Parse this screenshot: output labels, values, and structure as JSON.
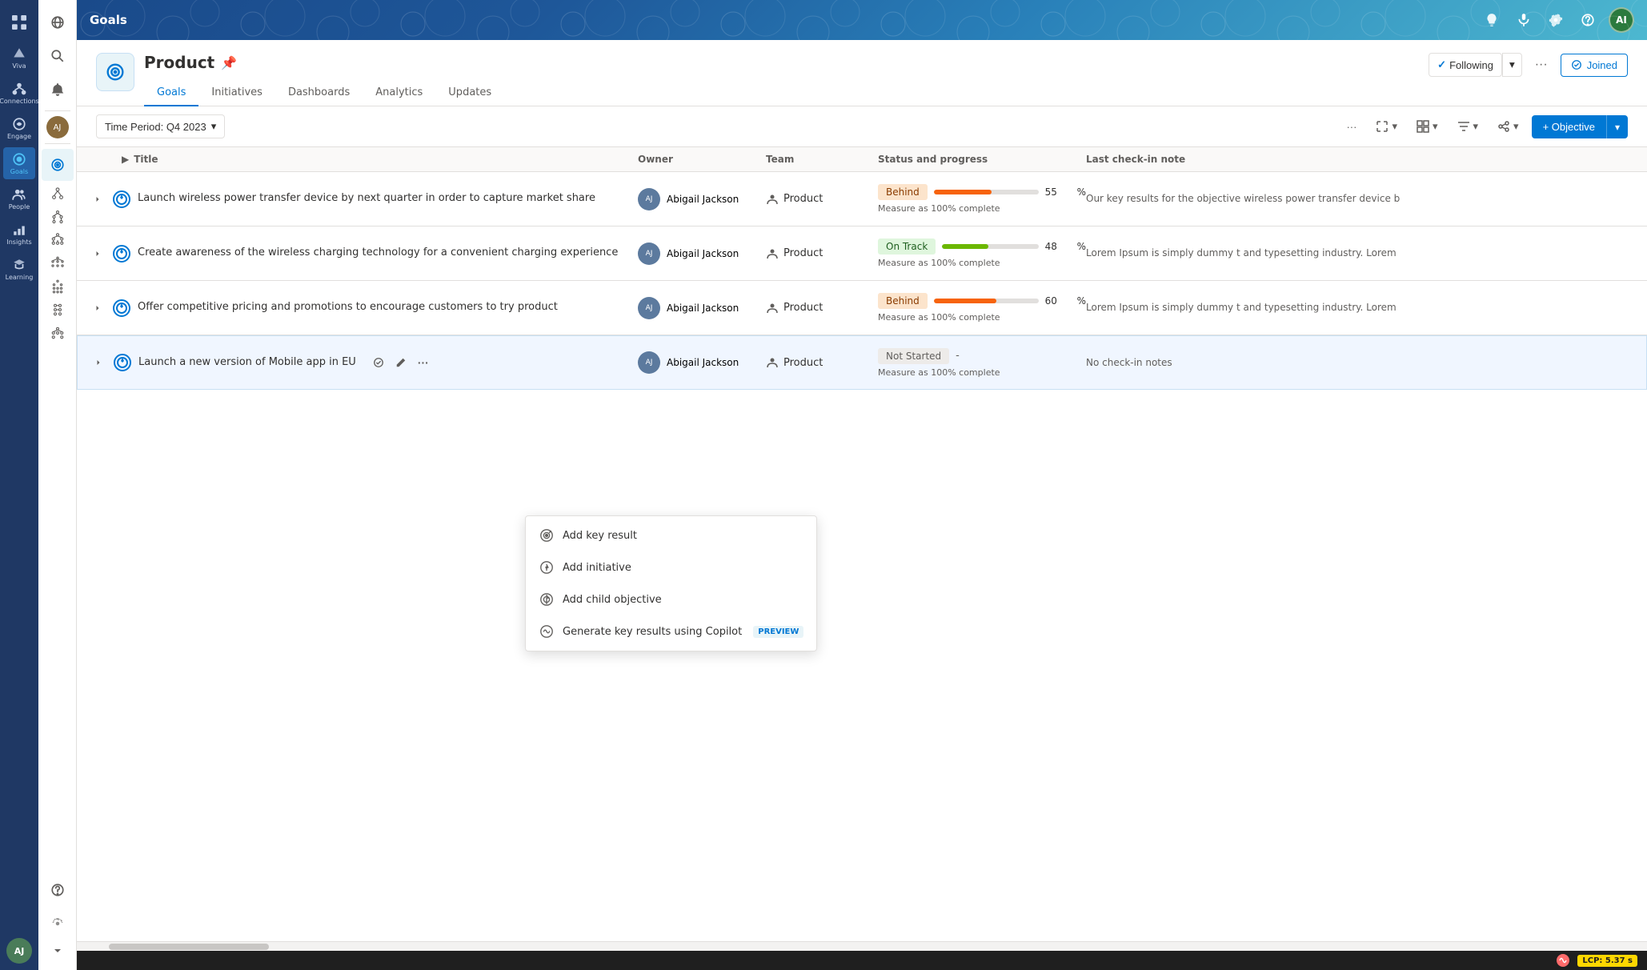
{
  "app": {
    "name": "Goals",
    "header_icons": [
      "lightbulb",
      "microphone",
      "settings",
      "avatar"
    ]
  },
  "nav_rail": {
    "items": [
      {
        "label": "",
        "icon": "grid"
      },
      {
        "label": "Viva",
        "icon": "viva"
      },
      {
        "label": "Connections",
        "icon": "connections"
      },
      {
        "label": "Engage",
        "icon": "engage"
      },
      {
        "label": "Goals",
        "icon": "goals",
        "active": true
      },
      {
        "label": "People",
        "icon": "people"
      },
      {
        "label": "Insights",
        "icon": "insights"
      },
      {
        "label": "Learning",
        "icon": "learning"
      }
    ],
    "avatar_initials": "AJ"
  },
  "sidebar": {
    "items": [
      {
        "icon": "globe",
        "label": ""
      },
      {
        "icon": "search",
        "label": ""
      },
      {
        "icon": "bell",
        "label": ""
      },
      {
        "icon": "target",
        "label": ""
      },
      {
        "icon": "people",
        "label": ""
      },
      {
        "icon": "chart",
        "label": "Insights",
        "active": false
      },
      {
        "icon": "learning",
        "label": "Learning",
        "active": false
      },
      {
        "icon": "settings",
        "label": ""
      },
      {
        "icon": "more",
        "label": ""
      }
    ],
    "avatar": "AJ"
  },
  "page": {
    "title": "Product",
    "pin_icon": "📌",
    "tabs": [
      {
        "label": "Goals",
        "active": true
      },
      {
        "label": "Initiatives",
        "active": false
      },
      {
        "label": "Dashboards",
        "active": false
      },
      {
        "label": "Analytics",
        "active": false
      },
      {
        "label": "Updates",
        "active": false
      }
    ],
    "following_label": "Following",
    "more_label": "···",
    "joined_label": "Joined"
  },
  "toolbar": {
    "time_period_label": "Time Period: Q4 2023",
    "more_label": "···",
    "objective_label": "+ Objective"
  },
  "table": {
    "columns": [
      "Title",
      "Owner",
      "Team",
      "Status and progress",
      "Last check-in note"
    ],
    "rows": [
      {
        "id": 1,
        "title": "Launch wireless power transfer device by next quarter in order to capture market share",
        "owner": "Abigail Jackson",
        "owner_initials": "AJ",
        "team": "Product",
        "status": "Behind",
        "status_type": "behind",
        "progress": 55,
        "measure": "Measure as 100% complete",
        "check_note": "Our key results for the objective wireless power transfer device b"
      },
      {
        "id": 2,
        "title": "Create awareness of the wireless charging technology for a convenient charging experience",
        "owner": "Abigail Jackson",
        "owner_initials": "AJ",
        "team": "Product",
        "status": "On Track",
        "status_type": "ontrack",
        "progress": 48,
        "measure": "Measure as 100% complete",
        "check_note": "Lorem Ipsum is simply dummy t and typesetting industry. Lorem"
      },
      {
        "id": 3,
        "title": "Offer competitive pricing and promotions to encourage customers to try product",
        "owner": "Abigail Jackson",
        "owner_initials": "AJ",
        "team": "Product",
        "status": "Behind",
        "status_type": "behind",
        "progress": 60,
        "measure": "Measure as 100% complete",
        "check_note": "Lorem Ipsum is simply dummy t and typesetting industry. Lorem"
      },
      {
        "id": 4,
        "title": "Launch a new version of Mobile app in EU",
        "owner": "Abigail Jackson",
        "owner_initials": "AJ",
        "team": "Product",
        "status": "Not Started",
        "status_type": "notstarted",
        "progress": 0,
        "measure": "Measure as 100% complete",
        "check_note": "No check-in notes",
        "has_menu": true
      }
    ]
  },
  "context_menu": {
    "visible": true,
    "items": [
      {
        "label": "Add key result",
        "icon": "key-result"
      },
      {
        "label": "Add initiative",
        "icon": "initiative"
      },
      {
        "label": "Add child objective",
        "icon": "child-objective"
      },
      {
        "label": "Generate key results using Copilot",
        "icon": "copilot",
        "badge": "PREVIEW"
      }
    ]
  },
  "status_bar": {
    "lcp_label": "LCP: 5.37 s"
  }
}
